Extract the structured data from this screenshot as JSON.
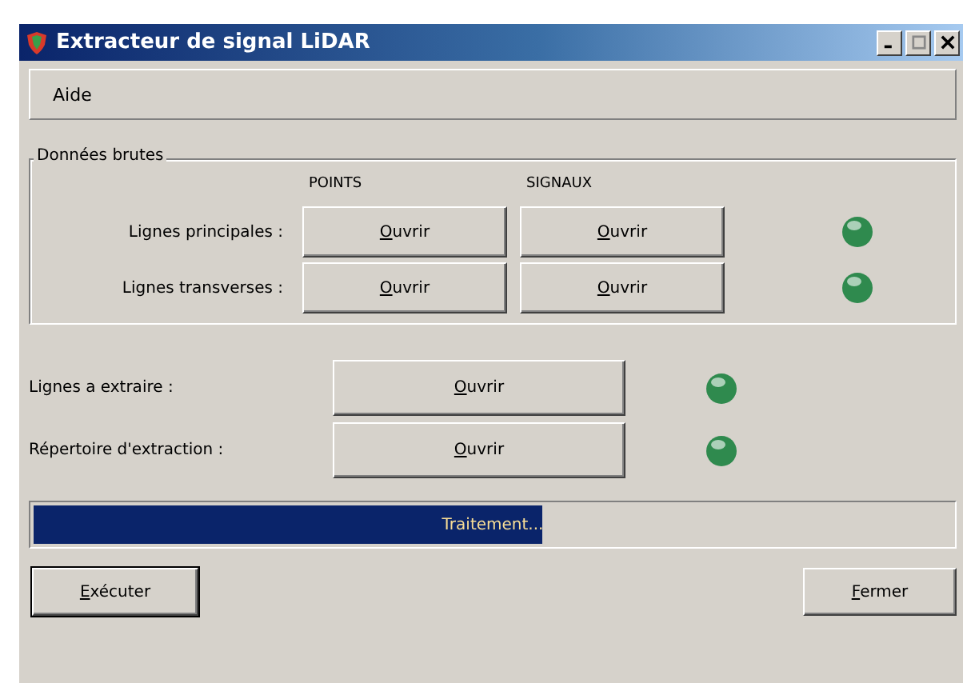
{
  "window": {
    "title": "Extracteur de signal LiDAR"
  },
  "menu": [
    {
      "label": "Aide"
    }
  ],
  "raw_data": {
    "title": "Données brutes",
    "columns": [
      "POINTS",
      "SIGNAUX"
    ],
    "rows": [
      {
        "label": "Lignes principales :",
        "buttons": [
          "Ouvrir",
          "Ouvrir"
        ],
        "color": "#2f8a4e"
      },
      {
        "label": "Lignes transverses :",
        "buttons": [
          "Ouvrir",
          "Ouvrir"
        ],
        "color": "#2f8a4e"
      }
    ]
  },
  "outputs": [
    {
      "label": "Lignes a extraire :",
      "button": "Ouvrir",
      "color": "#2f8a4e"
    },
    {
      "label": "Répertoire d'extraction :",
      "button": "Ouvrir",
      "color": "#2f8a4e"
    }
  ],
  "progress": {
    "level": 0.55,
    "text": "Traitement..."
  },
  "buttons": [
    {
      "label": "Exécuter",
      "kind": "default"
    },
    {
      "label": "Fermer",
      "kind": "normal"
    }
  ]
}
